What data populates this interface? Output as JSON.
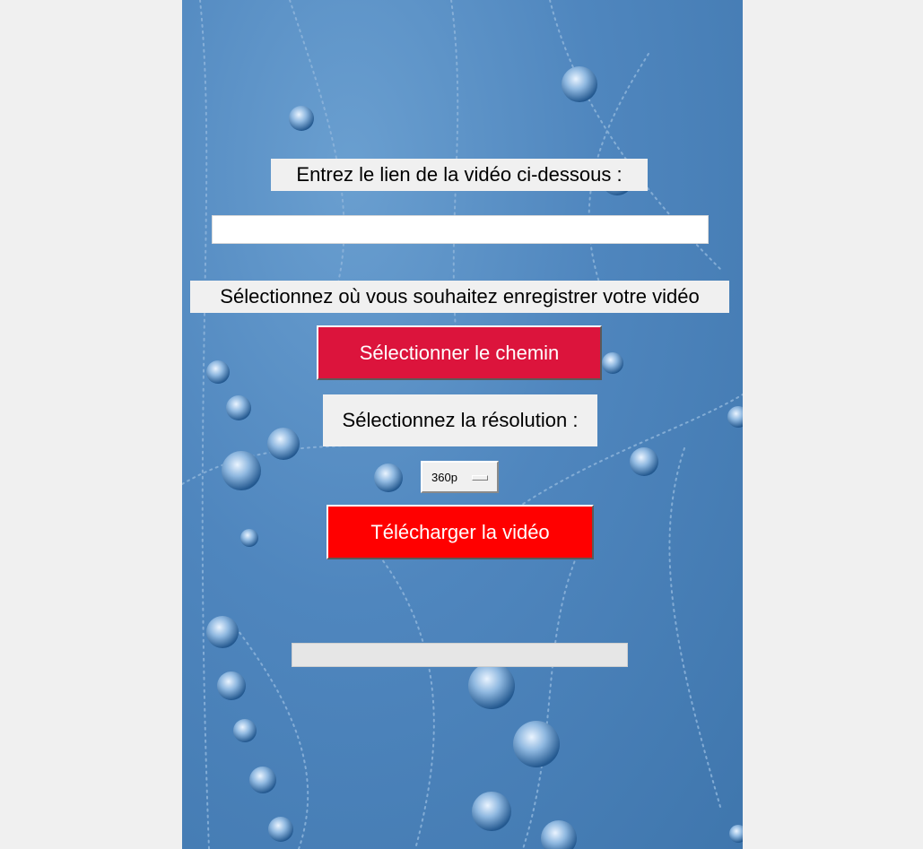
{
  "window": {
    "url_prompt": "Entrez le lien de la vidéo ci-dessous :",
    "url_value": "",
    "save_prompt": "Sélectionnez où vous souhaitez enregistrer votre vidéo",
    "select_path_label": "Sélectionner le chemin",
    "resolution_prompt": "Sélectionnez la résolution :",
    "resolution_value": "360p",
    "download_label": "Télécharger la vidéo",
    "progress": 0
  },
  "colors": {
    "path_button": "#dc143c",
    "download_button": "#ff0000",
    "background": "#4f86be"
  },
  "background_image": "dewdrops-on-spider-web"
}
